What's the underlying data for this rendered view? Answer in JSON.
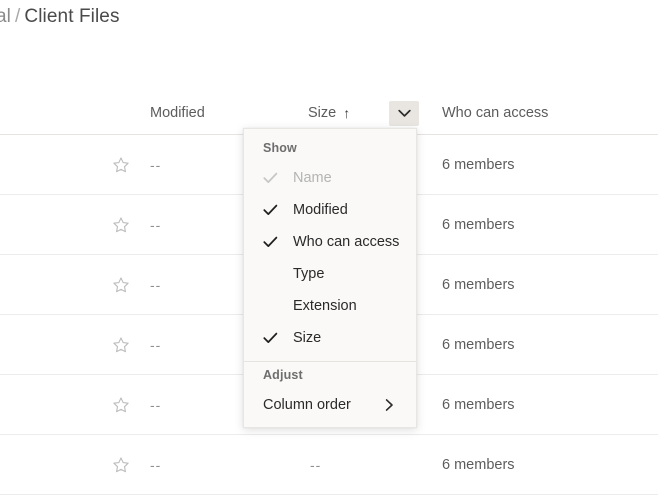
{
  "breadcrumb": {
    "truncated_parent": "al",
    "separator": "/",
    "current": "Client Files"
  },
  "table": {
    "columns": {
      "modified": "Modified",
      "size": "Size",
      "size_sort_indicator": "↑",
      "access": "Who can access"
    },
    "rows": [
      {
        "star": "star-outline-icon",
        "modified": "--",
        "size": "",
        "access": "6 members"
      },
      {
        "star": "star-outline-icon",
        "modified": "--",
        "size": "",
        "access": "6 members"
      },
      {
        "star": "star-outline-icon",
        "modified": "--",
        "size": "",
        "access": "6 members"
      },
      {
        "star": "star-outline-icon",
        "modified": "--",
        "size": "",
        "access": "6 members"
      },
      {
        "star": "star-outline-icon",
        "modified": "--",
        "size": "",
        "access": "6 members"
      },
      {
        "star": "star-outline-icon",
        "modified": "--",
        "size": "--",
        "access": "6 members"
      }
    ]
  },
  "column_menu": {
    "trigger_icon": "chevron-down-icon",
    "show_label": "Show",
    "show_items": [
      {
        "label": "Name",
        "checked": true,
        "disabled": true
      },
      {
        "label": "Modified",
        "checked": true,
        "disabled": false
      },
      {
        "label": "Who can access",
        "checked": true,
        "disabled": false
      },
      {
        "label": "Type",
        "checked": false,
        "disabled": false
      },
      {
        "label": "Extension",
        "checked": false,
        "disabled": false
      },
      {
        "label": "Size",
        "checked": true,
        "disabled": false
      }
    ],
    "adjust_label": "Adjust",
    "adjust_items": [
      {
        "label": "Column order",
        "submenu_icon": "chevron-right-icon"
      }
    ]
  },
  "colors": {
    "page_background": "#ffffff",
    "menu_background": "#faf9f7",
    "menu_border": "#e8e6e3",
    "row_divider": "#ececec",
    "header_text": "#5c5c5c",
    "muted_text": "#8f8f8f",
    "disabled_text": "#b4b4b4",
    "button_hover": "#e9e6e2"
  }
}
